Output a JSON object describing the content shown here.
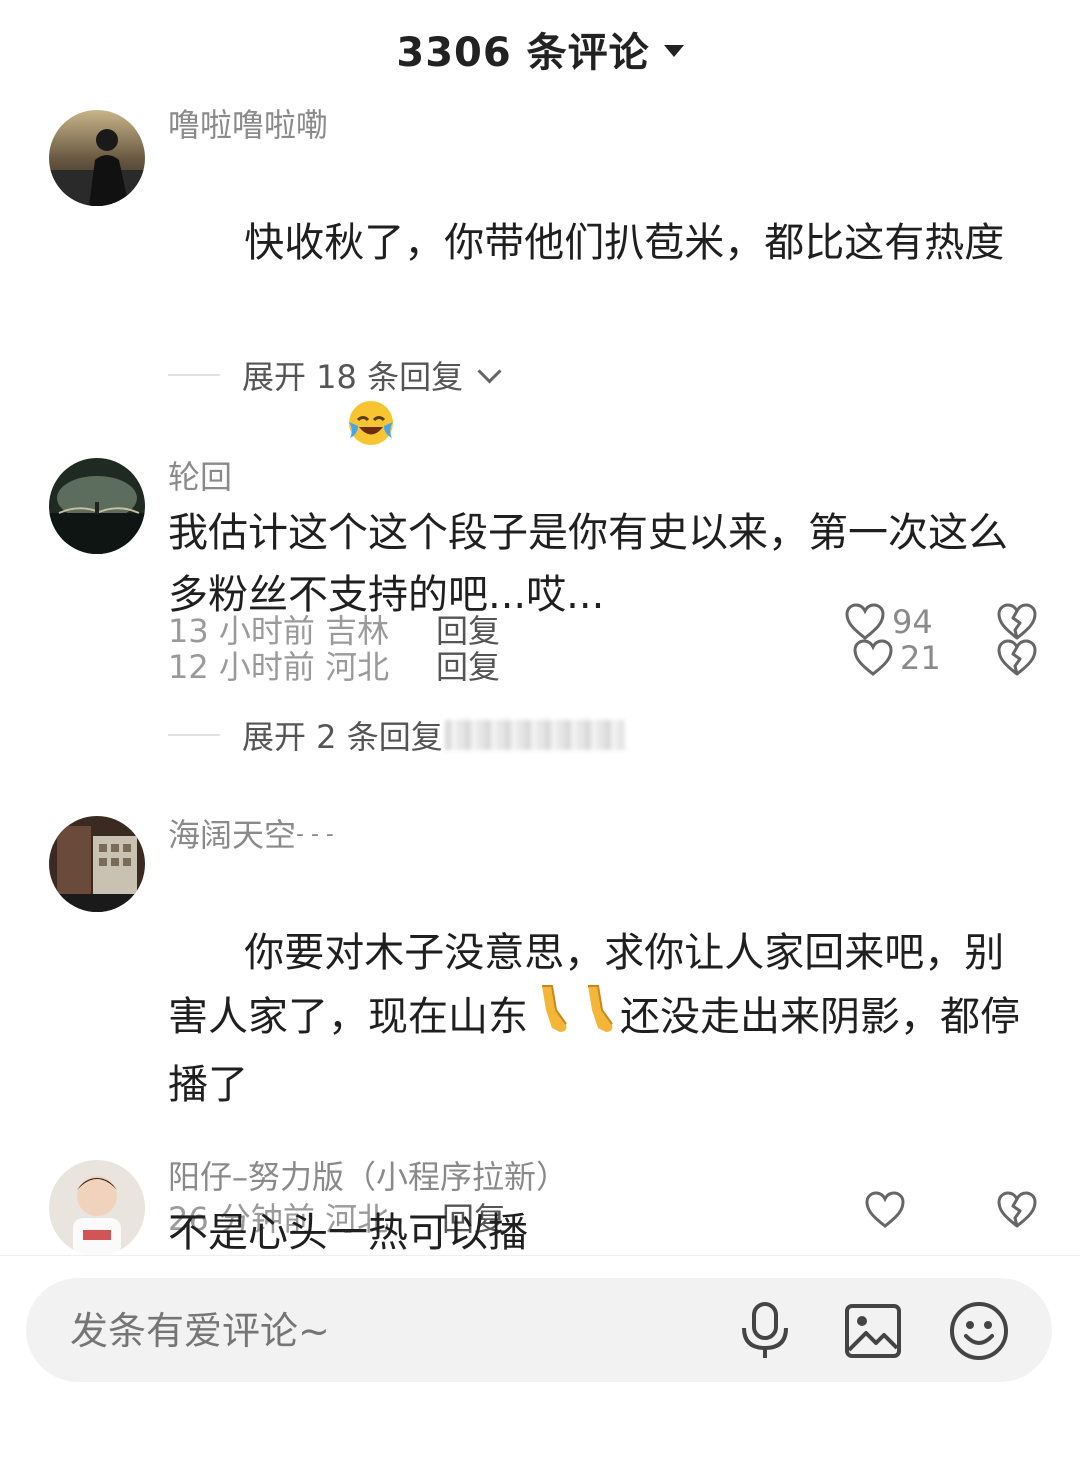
{
  "header": {
    "title": "3306 条评论"
  },
  "comments": [
    {
      "username": "噜啦噜啦嘞",
      "text": "快收秋了，你带他们扒苞米，都比这有热度",
      "emoji": "face-with-tears-of-joy",
      "time": "13 小时前 吉林",
      "reply_label": "回复",
      "likes": "94",
      "expand_label": "展开 18 条回复"
    },
    {
      "username": "轮回",
      "text": "我估计这个这个段子是你有史以来，第一次这么多粉丝不支持的吧...哎...",
      "time": "12 小时前 河北",
      "reply_label": "回复",
      "likes": "21",
      "expand_label": "展开 2 条回复"
    },
    {
      "username": "海阔天空",
      "username_suffix": "- - -",
      "text_before": "你要对木子没意思，求你让人家回来吧，别害人家了，现在山东",
      "text_after": "还没走出来阴影，都停播了",
      "emoji": "leg",
      "time": "26 分钟前 河北",
      "reply_label": "回复",
      "likes": ""
    },
    {
      "username": "阳仔–努力版（小程序拉新）",
      "text": "不是心头一热可以播"
    }
  ],
  "composer": {
    "placeholder": "发条有爱评论~",
    "icons": [
      "microphone-icon",
      "image-icon",
      "emoji-icon"
    ]
  },
  "colors": {
    "text": "#1f1f1f",
    "muted": "#8a8a8a",
    "input_bg": "#f2f2f2"
  }
}
